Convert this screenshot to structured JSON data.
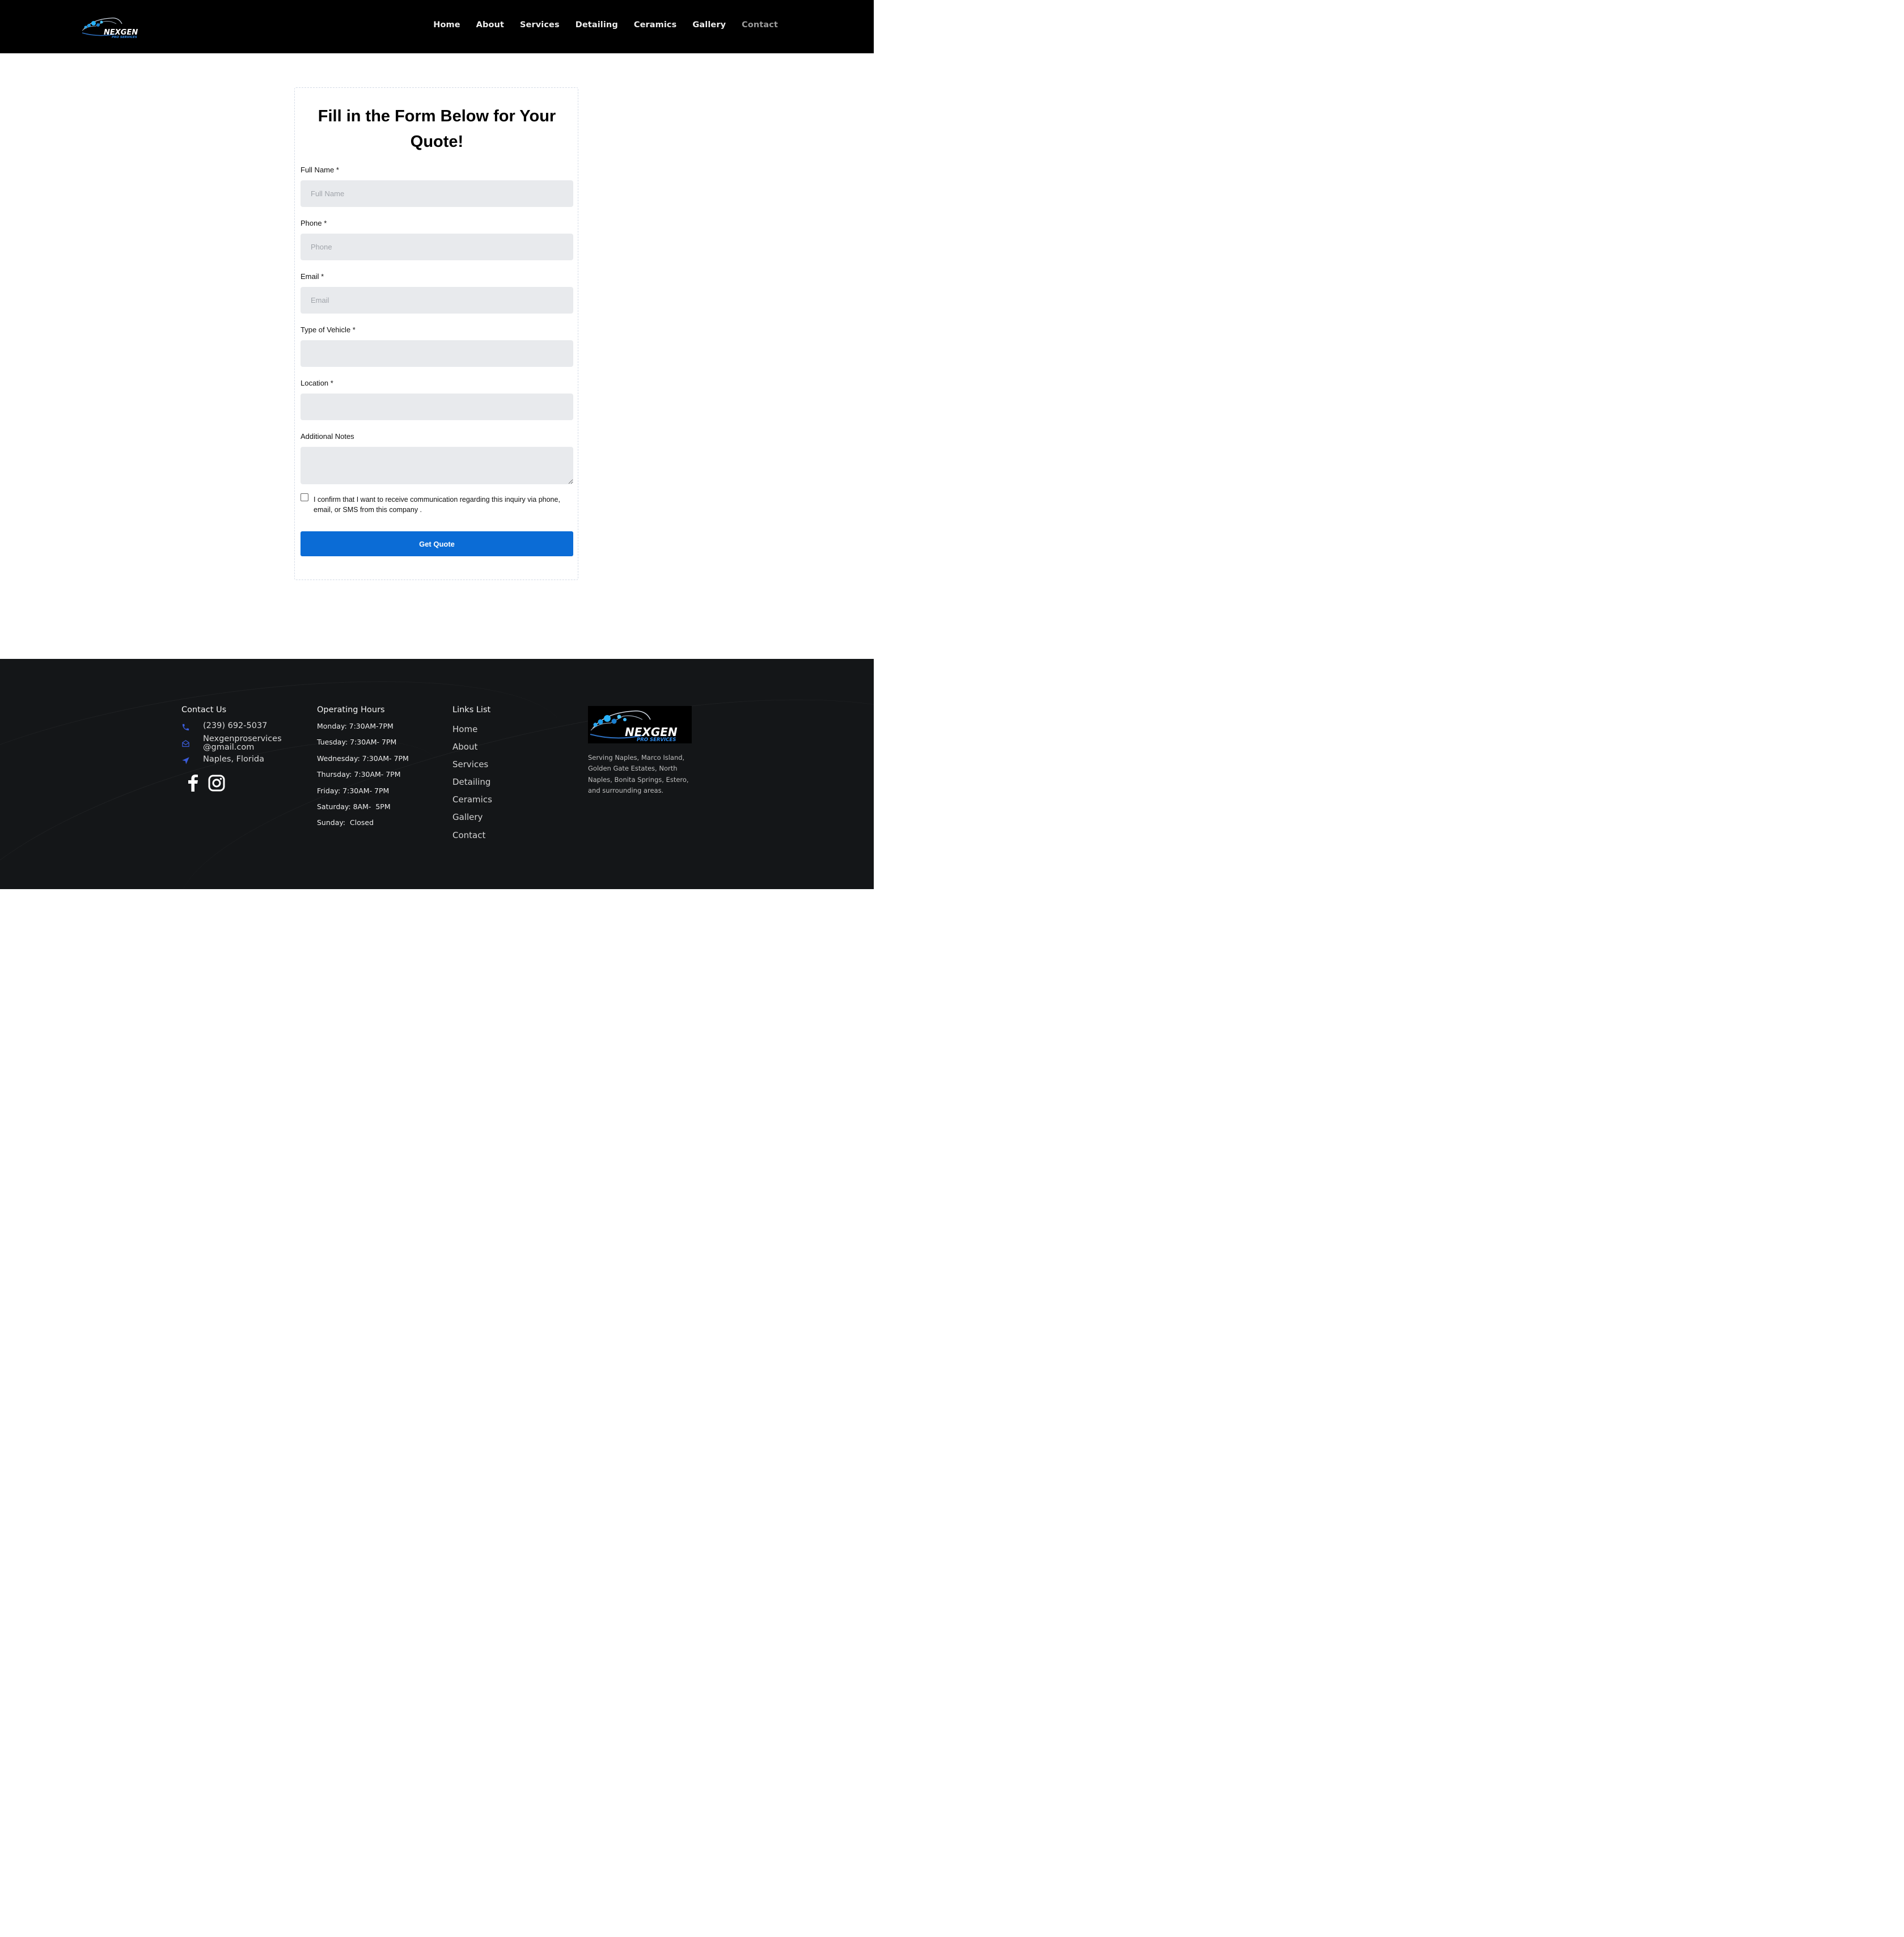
{
  "brand": {
    "name": "NEXGEN",
    "tagline": "PRO SERVICES"
  },
  "nav": {
    "items": [
      "Home",
      "About",
      "Services",
      "Detailing",
      "Ceramics",
      "Gallery",
      "Contact"
    ],
    "active": "Contact"
  },
  "form": {
    "title": "Fill in the Form Below for Your Quote!",
    "fields": [
      {
        "label": "Full Name *",
        "placeholder": "Full Name",
        "value": ""
      },
      {
        "label": "Phone *",
        "placeholder": "Phone",
        "value": ""
      },
      {
        "label": "Email *",
        "placeholder": "Email",
        "value": ""
      },
      {
        "label": "Type of Vehicle *",
        "placeholder": "",
        "value": ""
      },
      {
        "label": "Location *",
        "placeholder": "",
        "value": ""
      }
    ],
    "notes_label": "Additional Notes",
    "notes_value": "",
    "consent_text": "I confirm that I want to receive communication regarding this inquiry via phone, email, or SMS from this company .",
    "consent_checked": false,
    "submit_label": "Get Quote"
  },
  "footer": {
    "contact": {
      "title": "Contact Us",
      "phone": "(239) 692-5037",
      "email_line1": "Nexgenproservices",
      "email_line2": "@gmail.com",
      "location": "Naples, Florida",
      "icons": [
        "phone-icon",
        "envelope-icon",
        "location-arrow-icon"
      ],
      "social": [
        "facebook-icon",
        "instagram-icon"
      ]
    },
    "hours": {
      "title": "Operating Hours",
      "lines": [
        "Monday: 7:30AM-7PM",
        "Tuesday: 7:30AM- 7PM",
        "Wednesday: 7:30AM- 7PM",
        "Thursday: 7:30AM- 7PM",
        "Friday: 7:30AM- 7PM",
        "Saturday: 8AM-  5PM",
        "Sunday:  Closed"
      ]
    },
    "links": {
      "title": "Links List",
      "items": [
        "Home",
        "About",
        "Services",
        "Detailing",
        "Ceramics",
        "Gallery",
        "Contact"
      ]
    },
    "about": {
      "serving": "Serving Naples, Marco Island, Golden Gate Estates, North Naples, Bonita Springs, Estero, and surrounding areas."
    }
  },
  "colors": {
    "header_bg": "#000000",
    "accent_blue": "#0b6cd6",
    "icon_blue": "#3a5bd9",
    "footer_bg": "#141618",
    "input_bg": "#e8eaed"
  }
}
